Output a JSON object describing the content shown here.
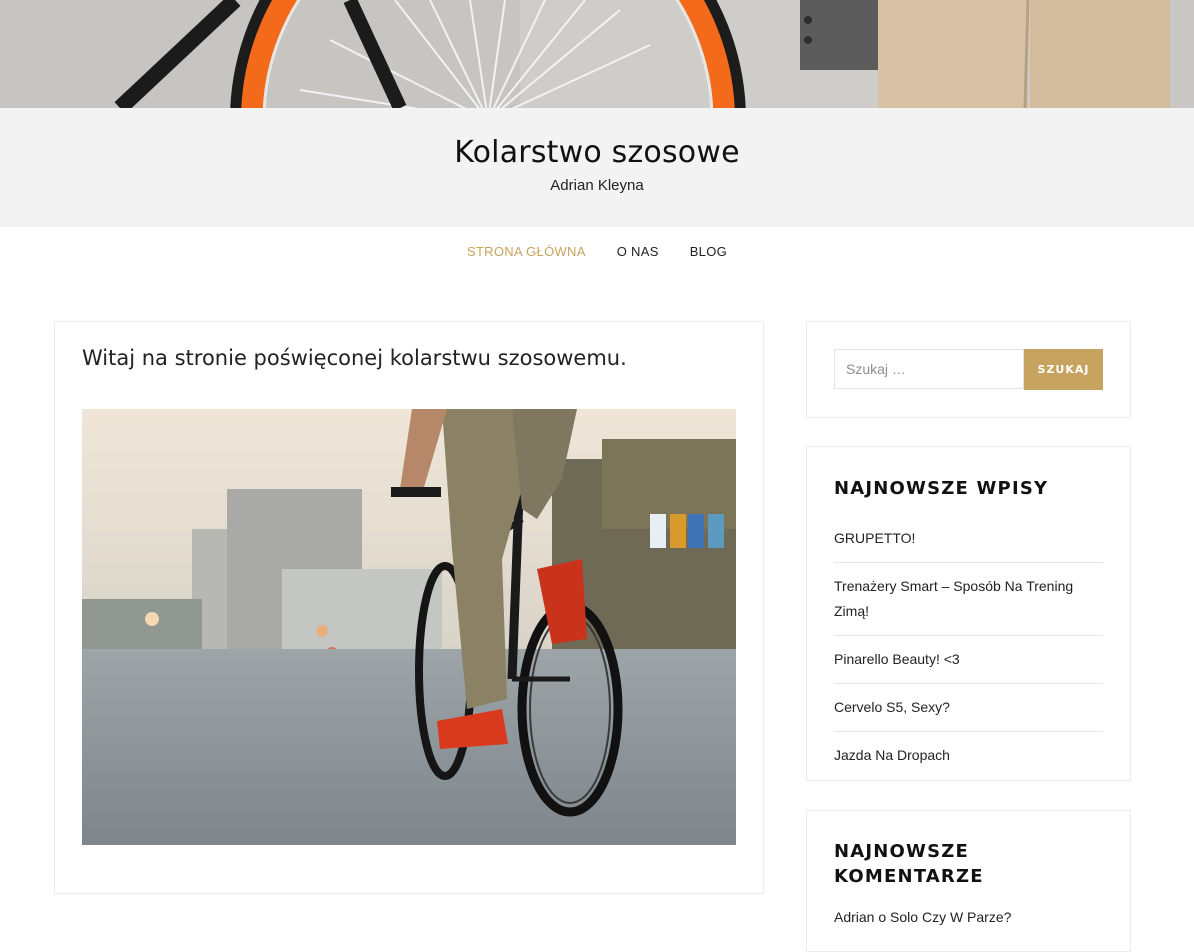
{
  "site": {
    "title": "Kolarstwo szosowe",
    "tagline": "Adrian Kleyna"
  },
  "nav": {
    "items": [
      {
        "label": "STRONA GŁÓWNA",
        "active": true
      },
      {
        "label": "O NAS",
        "active": false
      },
      {
        "label": "BLOG",
        "active": false
      }
    ]
  },
  "main": {
    "entry_title": "Witaj na stronie poświęconej kolarstwu szosowemu."
  },
  "search": {
    "placeholder": "Szukaj …",
    "button_label": "SZUKAJ"
  },
  "recent_posts": {
    "title": "NAJNOWSZE WPISY",
    "items": [
      "GRUPETTO!",
      "Trenażery Smart – Sposób Na Trening Zimą!",
      "Pinarello Beauty! <3",
      "Cervelo S5, Sexy?",
      "Jazda Na Dropach"
    ]
  },
  "recent_comments": {
    "title": "NAJNOWSZE KOMENTARZE",
    "items": [
      {
        "author": "Adrian",
        "connector": "o",
        "post": "Solo Czy W Parze?"
      }
    ]
  },
  "colors": {
    "accent": "#c6a460",
    "masthead_bg": "#f3f3f3"
  }
}
